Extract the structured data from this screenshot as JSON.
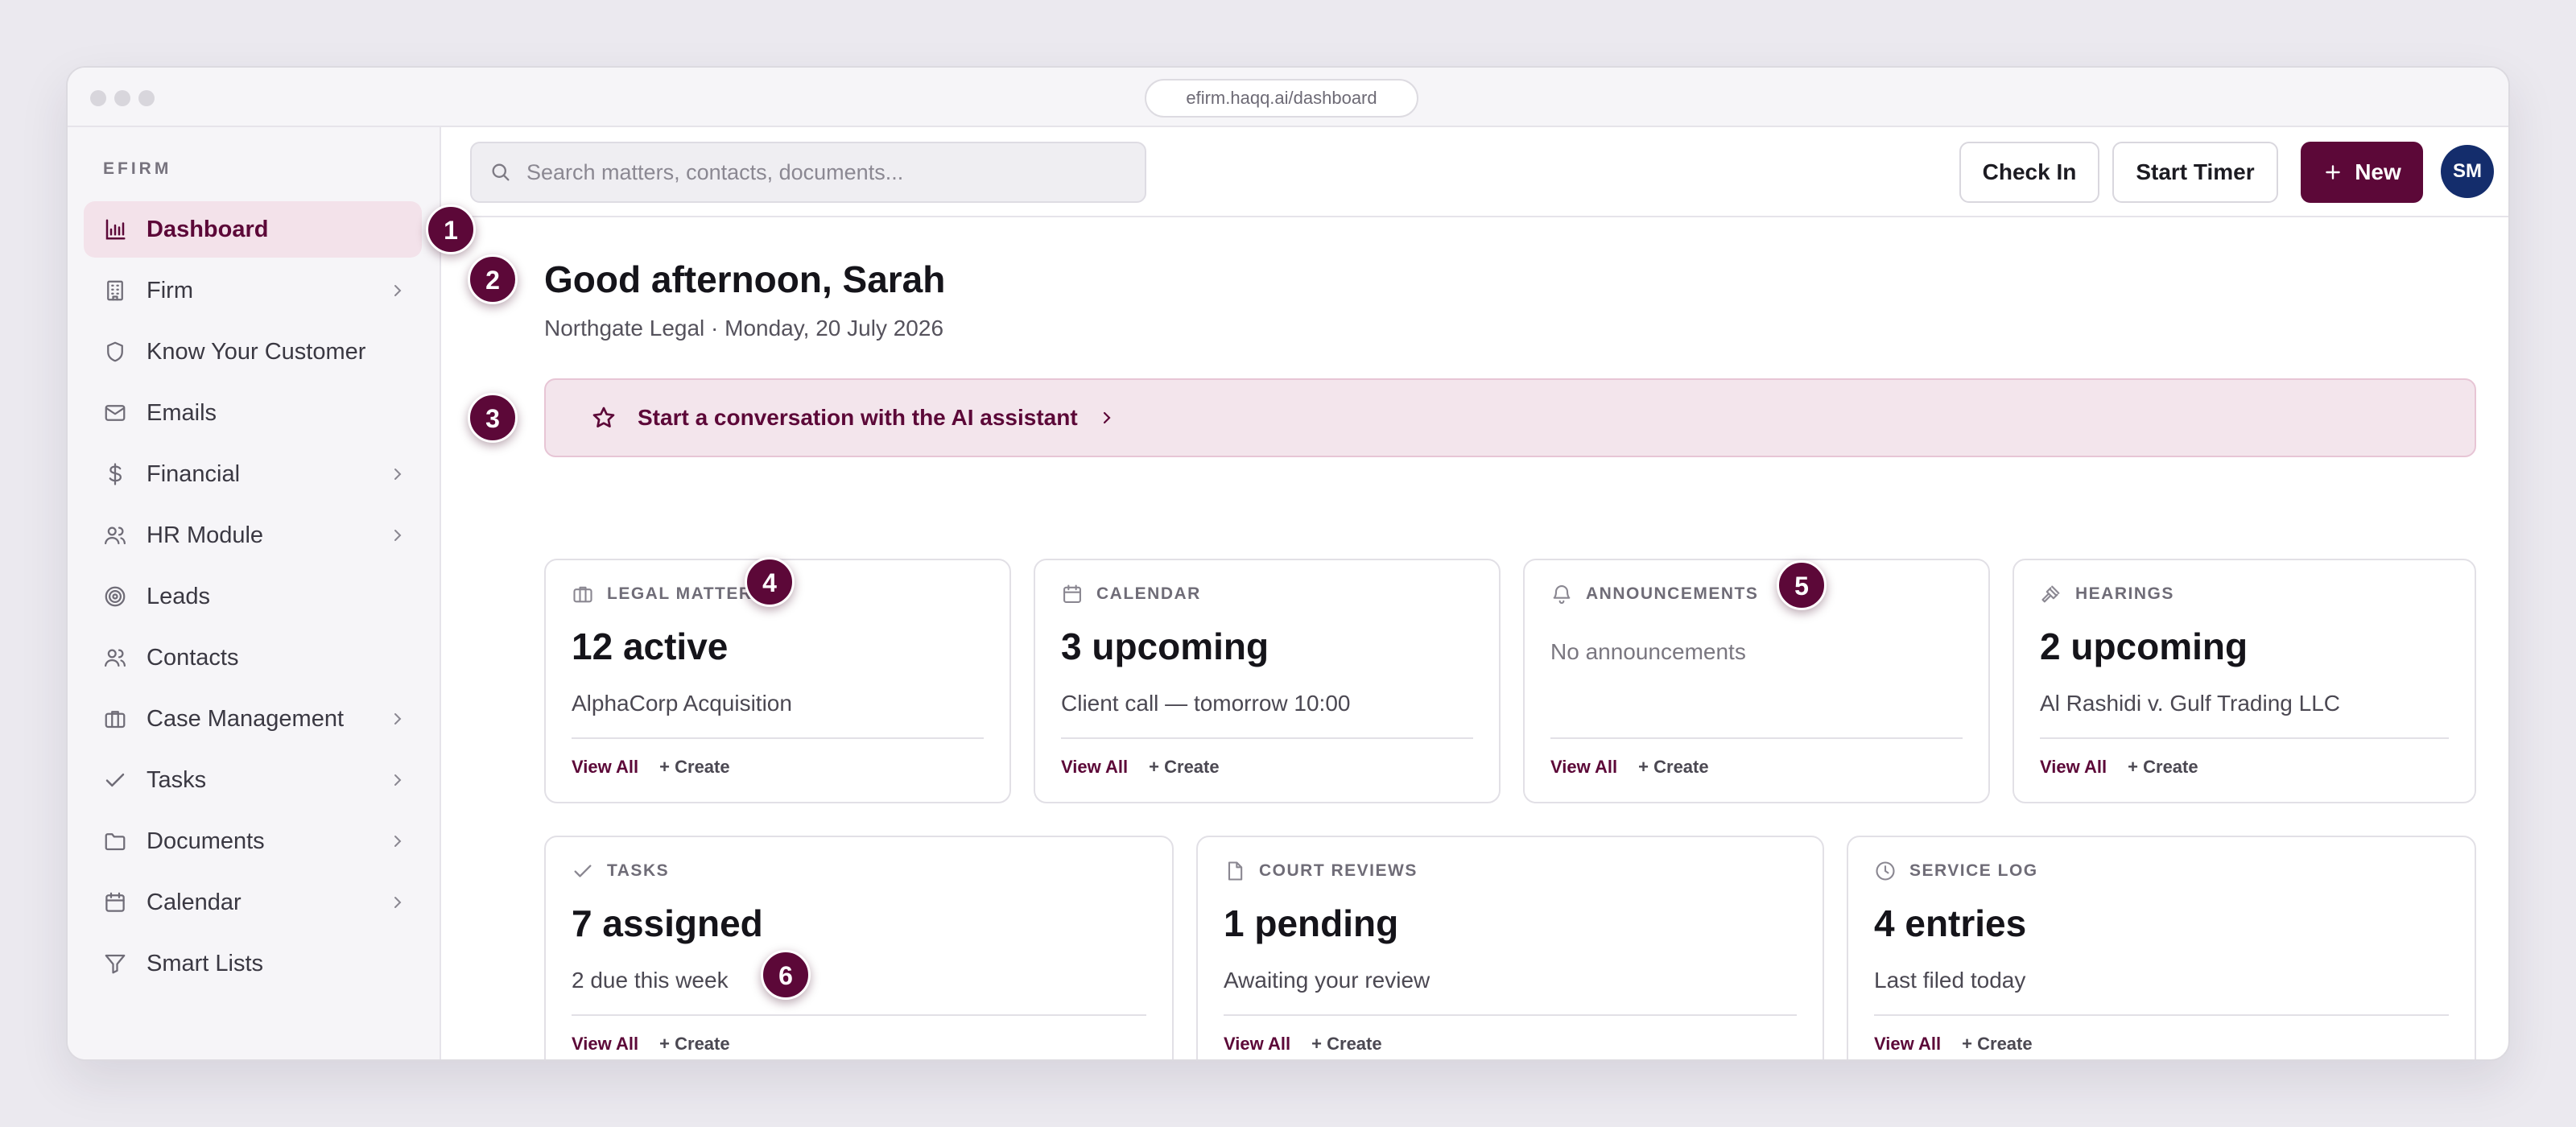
{
  "browser": {
    "url": "efirm.haqq.ai/dashboard"
  },
  "sidebar": {
    "brand": "EFIRM",
    "items": [
      {
        "label": "Dashboard",
        "icon": "bar-chart-icon",
        "active": true,
        "chevron": false
      },
      {
        "label": "Firm",
        "icon": "building-icon",
        "chevron": true
      },
      {
        "label": "Know Your Customer",
        "icon": "shield-icon",
        "chevron": false
      },
      {
        "label": "Emails",
        "icon": "mail-icon",
        "chevron": false
      },
      {
        "label": "Financial",
        "icon": "dollar-icon",
        "chevron": true
      },
      {
        "label": "HR Module",
        "icon": "users-icon",
        "chevron": true
      },
      {
        "label": "Leads",
        "icon": "target-icon",
        "chevron": false
      },
      {
        "label": "Contacts",
        "icon": "users-icon",
        "chevron": false
      },
      {
        "label": "Case Management",
        "icon": "briefcase-icon",
        "chevron": true
      },
      {
        "label": "Tasks",
        "icon": "check-icon",
        "chevron": true
      },
      {
        "label": "Documents",
        "icon": "folder-icon",
        "chevron": true
      },
      {
        "label": "Calendar",
        "icon": "calendar-icon",
        "chevron": true
      },
      {
        "label": "Smart Lists",
        "icon": "filter-icon",
        "chevron": false
      }
    ]
  },
  "topbar": {
    "search_placeholder": "Search matters, contacts, documents...",
    "check_in": "Check In",
    "start_timer": "Start Timer",
    "new_label": "New",
    "avatar_initials": "SM"
  },
  "main": {
    "greeting": "Good afternoon, Sarah",
    "subline": "Northgate Legal · Monday, 20 July 2026",
    "ai_banner": "Start a conversation with the AI assistant"
  },
  "cards": [
    {
      "title": "LEGAL MATTERS",
      "icon": "briefcase-icon",
      "value": "12 active",
      "desc": "AlphaCorp Acquisition",
      "view_all": "View All",
      "create": "+ Create"
    },
    {
      "title": "CALENDAR",
      "icon": "calendar-icon",
      "value": "3 upcoming",
      "desc": "Client call — tomorrow 10:00",
      "view_all": "View All",
      "create": "+ Create"
    },
    {
      "title": "ANNOUNCEMENTS",
      "icon": "bell-icon",
      "empty": "No announcements",
      "view_all": "View All",
      "create": "+ Create"
    },
    {
      "title": "HEARINGS",
      "icon": "gavel-icon",
      "value": "2 upcoming",
      "desc": "Al Rashidi v. Gulf Trading LLC",
      "view_all": "View All",
      "create": "+ Create"
    },
    {
      "title": "TASKS",
      "icon": "check-icon",
      "value": "7 assigned",
      "desc": "2 due this week",
      "view_all": "View All",
      "create": "+ Create"
    },
    {
      "title": "COURT REVIEWS",
      "icon": "document-icon",
      "value": "1 pending",
      "desc": "Awaiting your review",
      "view_all": "View All",
      "create": "+ Create"
    },
    {
      "title": "SERVICE LOG",
      "icon": "clock-icon",
      "value": "4 entries",
      "desc": "Last filed today",
      "view_all": "View All",
      "create": "+ Create"
    }
  ],
  "markers": [
    "1",
    "2",
    "3",
    "4",
    "5",
    "6"
  ],
  "colors": {
    "brand": "#5c0838",
    "brand_tint": "#f3e2ea",
    "avatar": "#142d6c"
  }
}
